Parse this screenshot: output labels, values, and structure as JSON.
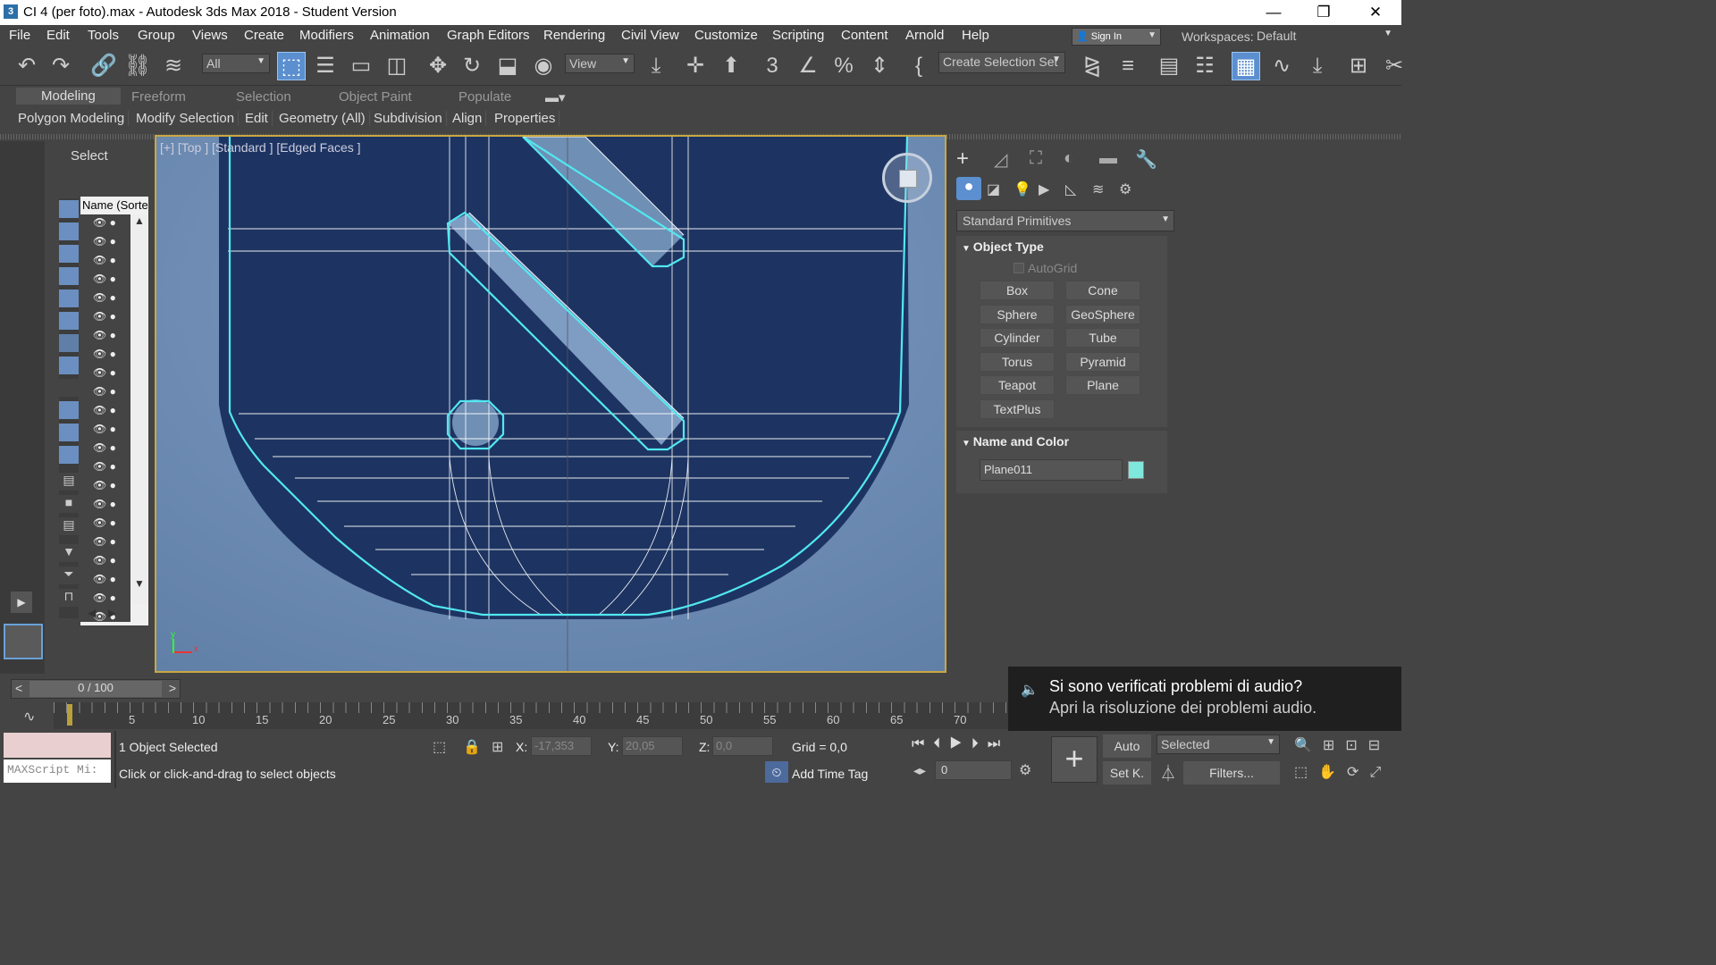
{
  "title": {
    "text": "CI 4 (per foto).max - Autodesk 3ds Max 2018 - Student Version",
    "minimize": "—",
    "restore": "❐",
    "close": "✕"
  },
  "menu": [
    "File",
    "Edit",
    "Tools",
    "Group",
    "Views",
    "Create",
    "Modifiers",
    "Animation",
    "Graph Editors",
    "Rendering",
    "Civil View",
    "Customize",
    "Scripting",
    "Content",
    "Arnold",
    "Help"
  ],
  "signin": "Sign In",
  "workspaces_label": "Workspaces:",
  "workspace_value": "Default",
  "toolbar": {
    "filter": "All",
    "refcoord": "View",
    "selset": "Create Selection Set"
  },
  "ribbon_tabs": [
    "Modeling",
    "Freeform",
    "Selection",
    "Object Paint",
    "Populate"
  ],
  "ribbon_sub": [
    "Polygon Modeling",
    "Modify Selection",
    "Edit",
    "Geometry (All)",
    "Subdivision",
    "Align",
    "Properties"
  ],
  "scene": {
    "select_label": "Select",
    "name_header": "Name (Sorte"
  },
  "viewport": {
    "label_plus": "[+]",
    "label_view": "[Top ]",
    "label_shading": "[Standard ]",
    "label_edged": "[Edged Faces ]",
    "axis_y": "y",
    "axis_x": "x"
  },
  "cmd": {
    "category": "Standard Primitives",
    "object_type_title": "Object Type",
    "autogrid": "AutoGrid",
    "buttons": [
      "Box",
      "Cone",
      "Sphere",
      "GeoSphere",
      "Cylinder",
      "Tube",
      "Torus",
      "Pyramid",
      "Teapot",
      "Plane",
      "TextPlus"
    ],
    "name_color_title": "Name and Color",
    "object_name": "Plane011",
    "object_color": "#7fe8dc"
  },
  "timeline": {
    "frame": "0 / 100",
    "ticks": [
      "5",
      "10",
      "15",
      "20",
      "25",
      "30",
      "35",
      "40",
      "45",
      "50",
      "55",
      "60",
      "65",
      "70"
    ]
  },
  "status": {
    "maxscript": "MAXScript Mi:",
    "selected": "1 Object Selected",
    "prompt": "Click or click-and-drag to select objects",
    "x_label": "X:",
    "x_value": "-17,353",
    "y_label": "Y:",
    "y_value": "20,05",
    "z_label": "Z:",
    "z_value": "0,0",
    "grid": "Grid = 0,0",
    "add_time_tag": "Add Time Tag",
    "auto": "Auto",
    "setkey": "Set K.",
    "selected_dd": "Selected",
    "filters": "Filters...",
    "frame_field": "0"
  },
  "toast": {
    "title": "Si sono verificati problemi di audio?",
    "body": "Apri la risoluzione dei problemi audio."
  }
}
